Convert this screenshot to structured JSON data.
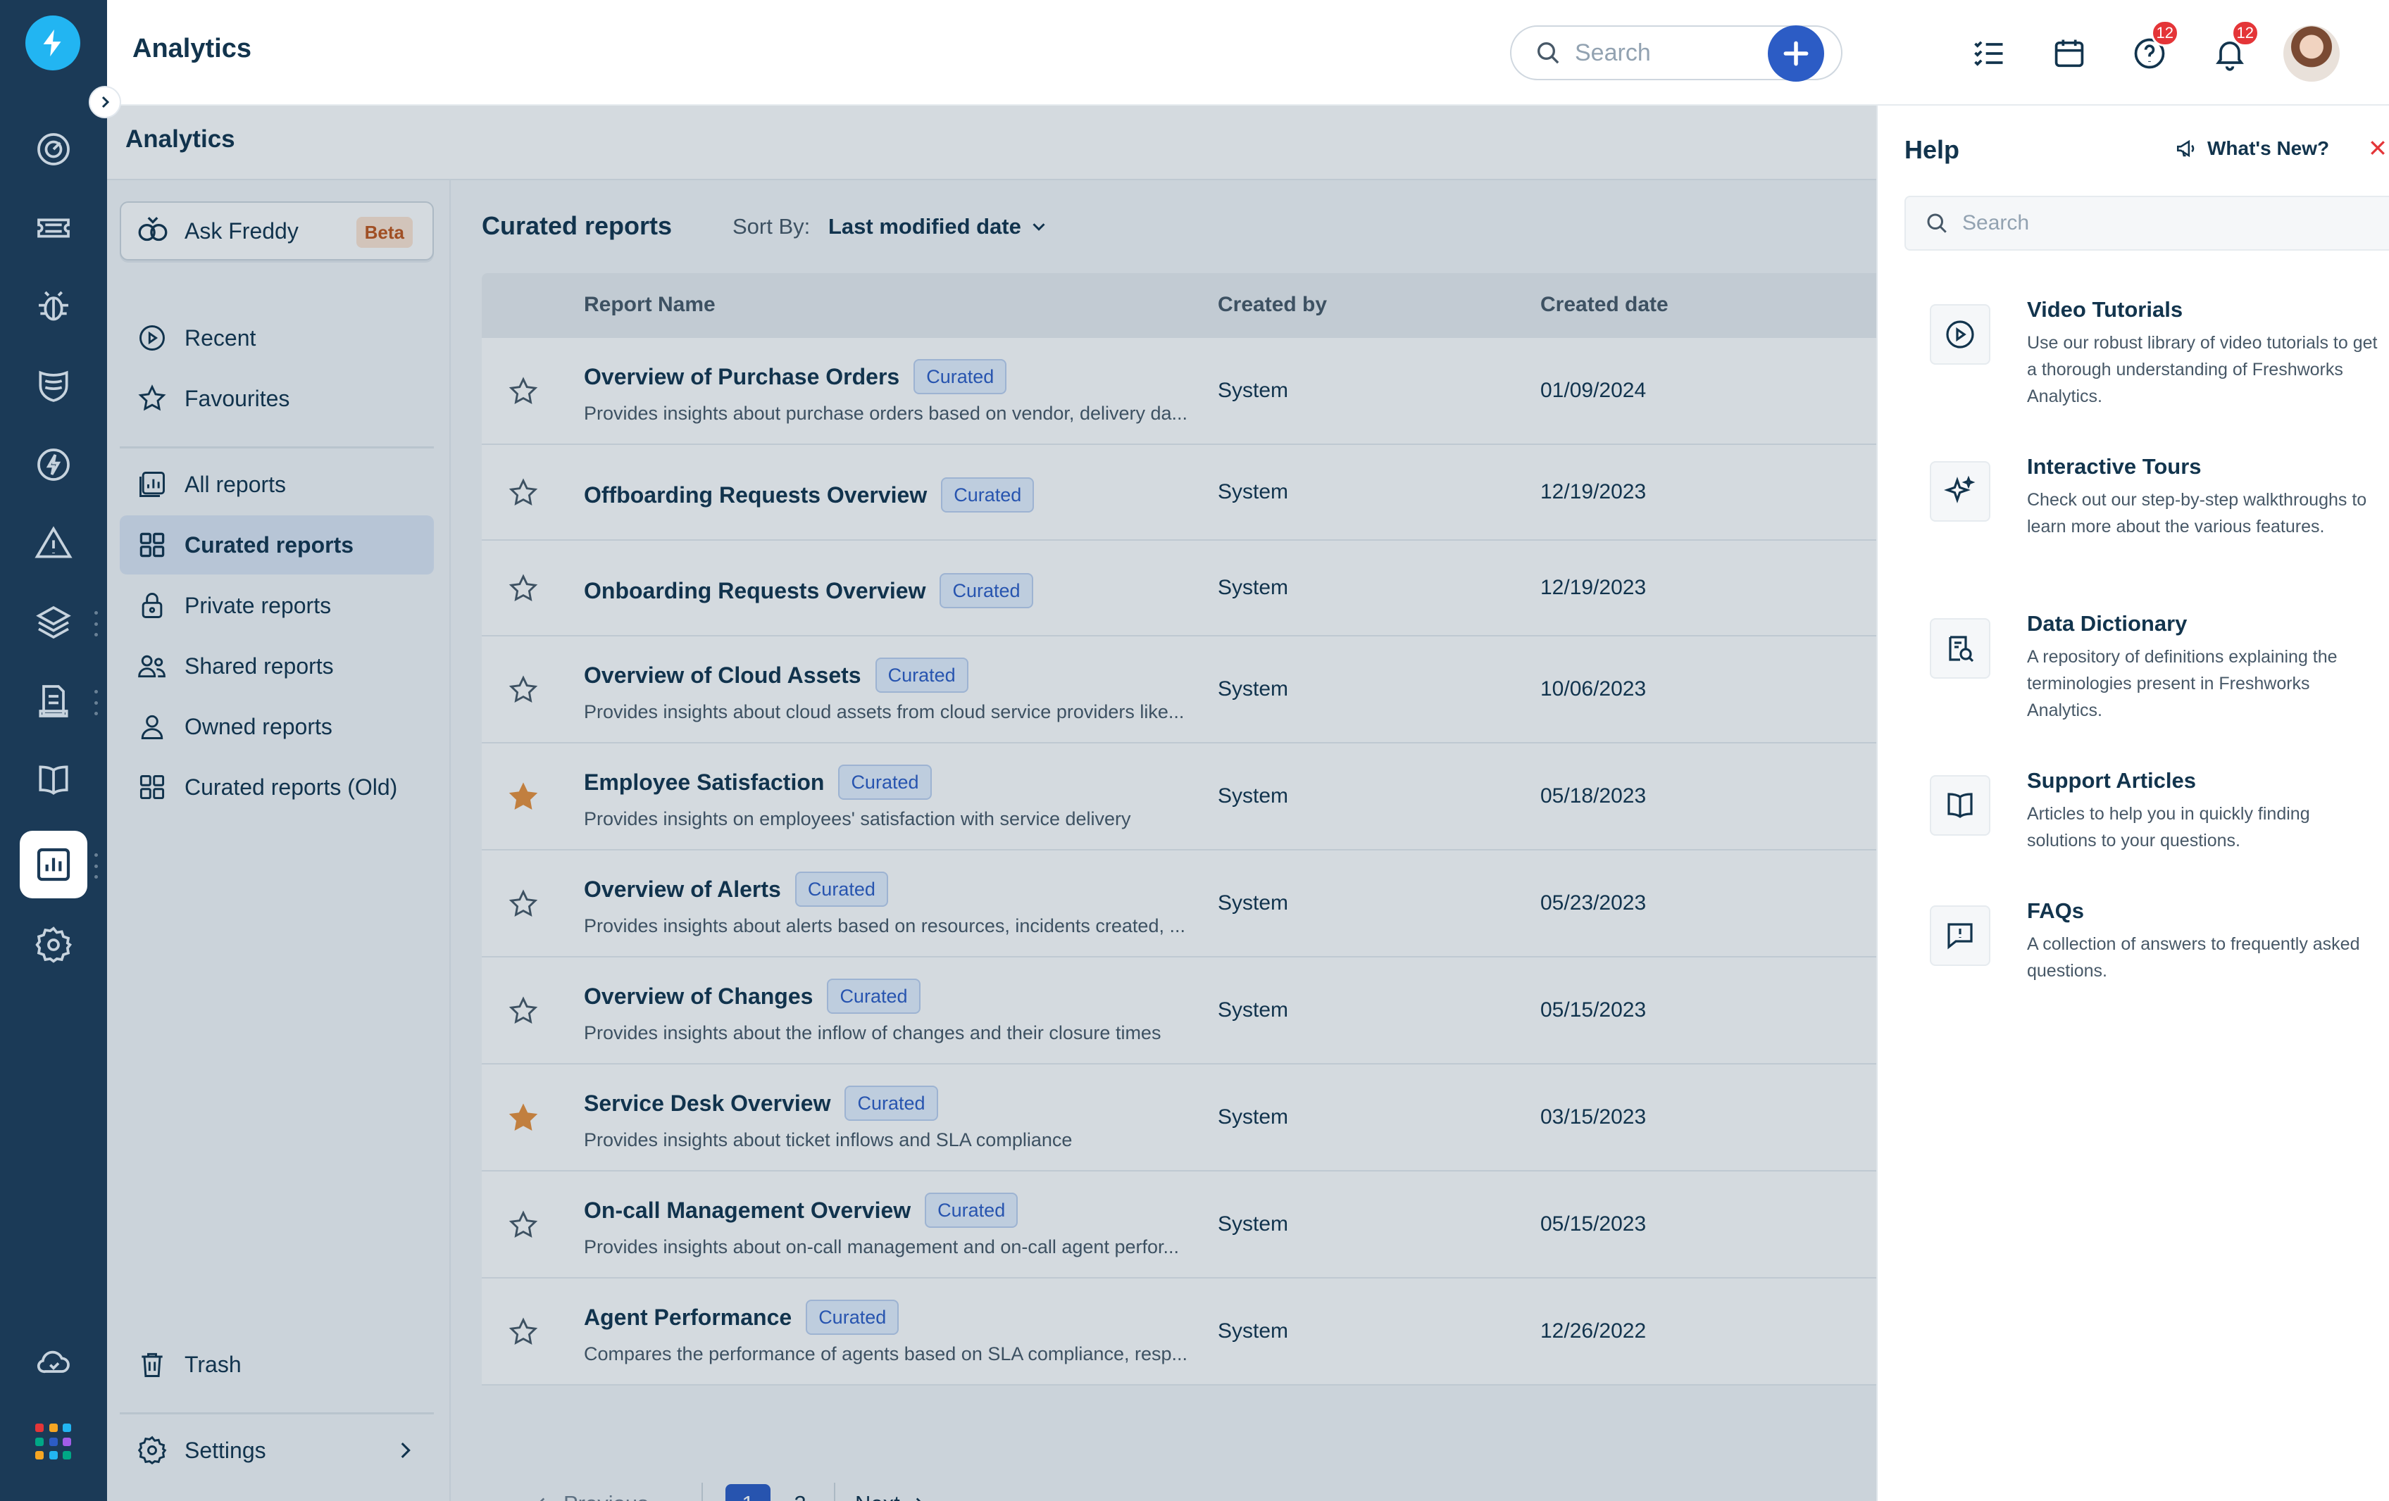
{
  "app": {
    "title": "Analytics"
  },
  "search": {
    "placeholder": "Search"
  },
  "header": {
    "help_badge": "12",
    "notifications_badge": "12"
  },
  "page": {
    "title": "Analytics"
  },
  "ask_freddy": {
    "label": "Ask Freddy",
    "badge": "Beta"
  },
  "nav": {
    "recent": "Recent",
    "favourites": "Favourites",
    "all_reports": "All reports",
    "curated_reports": "Curated reports",
    "private_reports": "Private reports",
    "shared_reports": "Shared reports",
    "owned_reports": "Owned reports",
    "curated_reports_old": "Curated reports (Old)",
    "trash": "Trash",
    "settings": "Settings"
  },
  "content": {
    "title": "Curated reports",
    "sort_label": "Sort By:",
    "sort_value": "Last modified date",
    "columns": {
      "name": "Report Name",
      "created_by": "Created by",
      "created_date": "Created date",
      "partial": "l"
    },
    "tag": "Curated",
    "rows": [
      {
        "name": "Overview of Purchase Orders",
        "desc": "Provides insights about purchase orders based on vendor, delivery da...",
        "created_by": "System",
        "date": "01/09/2024",
        "starred": false,
        "trail": "."
      },
      {
        "name": "Offboarding Requests Overview",
        "desc": "",
        "created_by": "System",
        "date": "12/19/2023",
        "starred": false,
        "trail": "."
      },
      {
        "name": "Onboarding Requests Overview",
        "desc": "",
        "created_by": "System",
        "date": "12/19/2023",
        "starred": false,
        "trail": "."
      },
      {
        "name": "Overview of Cloud Assets",
        "desc": "Provides insights about cloud assets from cloud service providers like...",
        "created_by": "System",
        "date": "10/06/2023",
        "starred": false,
        "trail": "."
      },
      {
        "name": "Employee Satisfaction",
        "desc": "Provides insights on employees' satisfaction with service delivery",
        "created_by": "System",
        "date": "05/18/2023",
        "starred": true,
        "trail": "l"
      },
      {
        "name": "Overview of Alerts",
        "desc": "Provides insights about alerts based on resources, incidents created, ...",
        "created_by": "System",
        "date": "05/23/2023",
        "starred": false,
        "trail": "l"
      },
      {
        "name": "Overview of Changes",
        "desc": "Provides insights about the inflow of changes and their closure times",
        "created_by": "System",
        "date": "05/15/2023",
        "starred": false,
        "trail": "l"
      },
      {
        "name": "Service Desk Overview",
        "desc": "Provides insights about ticket inflows and SLA compliance",
        "created_by": "System",
        "date": "03/15/2023",
        "starred": true,
        "trail": "l"
      },
      {
        "name": "On-call Management Overview",
        "desc": "Provides insights about on-call management and on-call agent perfor...",
        "created_by": "System",
        "date": "05/15/2023",
        "starred": false,
        "trail": "."
      },
      {
        "name": "Agent Performance",
        "desc": "Compares the performance of agents based on SLA compliance, resp...",
        "created_by": "System",
        "date": "12/26/2022",
        "starred": false,
        "trail": "."
      }
    ]
  },
  "pagination": {
    "previous": "Previous",
    "pages": [
      "1",
      "2"
    ],
    "current": "1",
    "next": "Next"
  },
  "help": {
    "title": "Help",
    "whats_new": "What's New?",
    "search_placeholder": "Search",
    "items": [
      {
        "title": "Video Tutorials",
        "desc": "Use our robust library of video tutorials to get a thorough understanding of Freshworks Analytics.",
        "icon": "play-circle-icon"
      },
      {
        "title": "Interactive Tours",
        "desc": "Check out our step-by-step walkthroughs to learn more about the various features.",
        "icon": "sparkle-icon"
      },
      {
        "title": "Data Dictionary",
        "desc": "A repository of definitions explaining the terminologies present in Freshworks Analytics.",
        "icon": "dictionary-icon"
      },
      {
        "title": "Support Articles",
        "desc": "Articles to help you in quickly finding solutions to your questions.",
        "icon": "book-icon"
      },
      {
        "title": "FAQs",
        "desc": "A collection of answers to frequently asked questions.",
        "icon": "faq-icon"
      }
    ]
  },
  "colors": {
    "rail": "#1b3a57",
    "accent": "#2c5cc5",
    "logo": "#22b5f2",
    "star_filled": "#e8903c",
    "badge": "#e43538",
    "curated_bg": "#e5f0fe"
  },
  "rail_icons": [
    "dashboard-icon",
    "tickets-icon",
    "problems-icon",
    "changes-icon",
    "releases-icon",
    "alerts-icon",
    "assets-icon",
    "service-catalog-icon",
    "solutions-icon",
    "analytics-icon",
    "admin-gear-icon",
    "cloud-icon",
    "apps-grid-icon"
  ]
}
